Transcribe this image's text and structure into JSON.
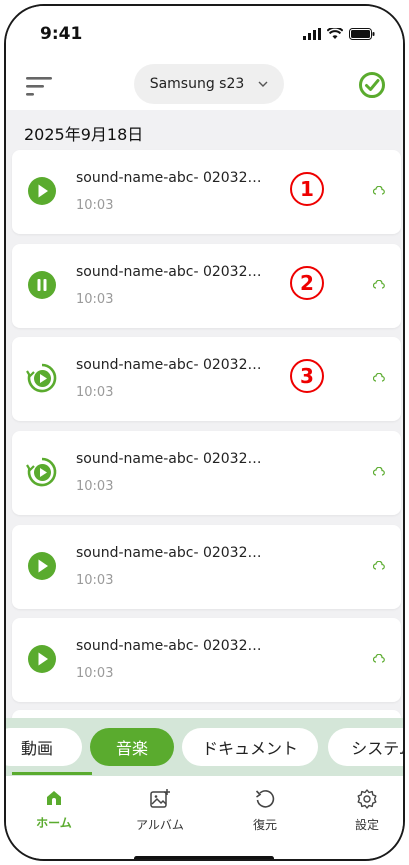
{
  "status": {
    "time": "9:41"
  },
  "header": {
    "device_name": "Samsung s23"
  },
  "date_label": "2025年9月18日",
  "items": [
    {
      "name": "sound-name-abc- 02032…",
      "time": "10:03",
      "icon": "play-icon",
      "marker": "1"
    },
    {
      "name": "sound-name-abc- 02032…",
      "time": "10:03",
      "icon": "pause-icon",
      "marker": "2"
    },
    {
      "name": "sound-name-abc- 02032…",
      "time": "10:03",
      "icon": "restore-play-icon",
      "marker": "3"
    },
    {
      "name": "sound-name-abc- 02032…",
      "time": "10:03",
      "icon": "restore-play-icon",
      "marker": ""
    },
    {
      "name": "sound-name-abc- 02032…",
      "time": "10:03",
      "icon": "play-icon",
      "marker": ""
    },
    {
      "name": "sound-name-abc- 02032…",
      "time": "10:03",
      "icon": "play-icon",
      "marker": ""
    }
  ],
  "categories": [
    "動画",
    "音楽",
    "ドキュメント",
    "システム"
  ],
  "active_category": "音楽",
  "tabs": [
    {
      "label": "ホーム",
      "icon": "home-icon",
      "active": true
    },
    {
      "label": "アルバム",
      "icon": "album-icon",
      "active": false
    },
    {
      "label": "復元",
      "icon": "restore-icon",
      "active": false
    },
    {
      "label": "設定",
      "icon": "settings-icon",
      "active": false
    }
  ],
  "colors": {
    "accent": "#5aab2e",
    "marker": "#e00000"
  }
}
